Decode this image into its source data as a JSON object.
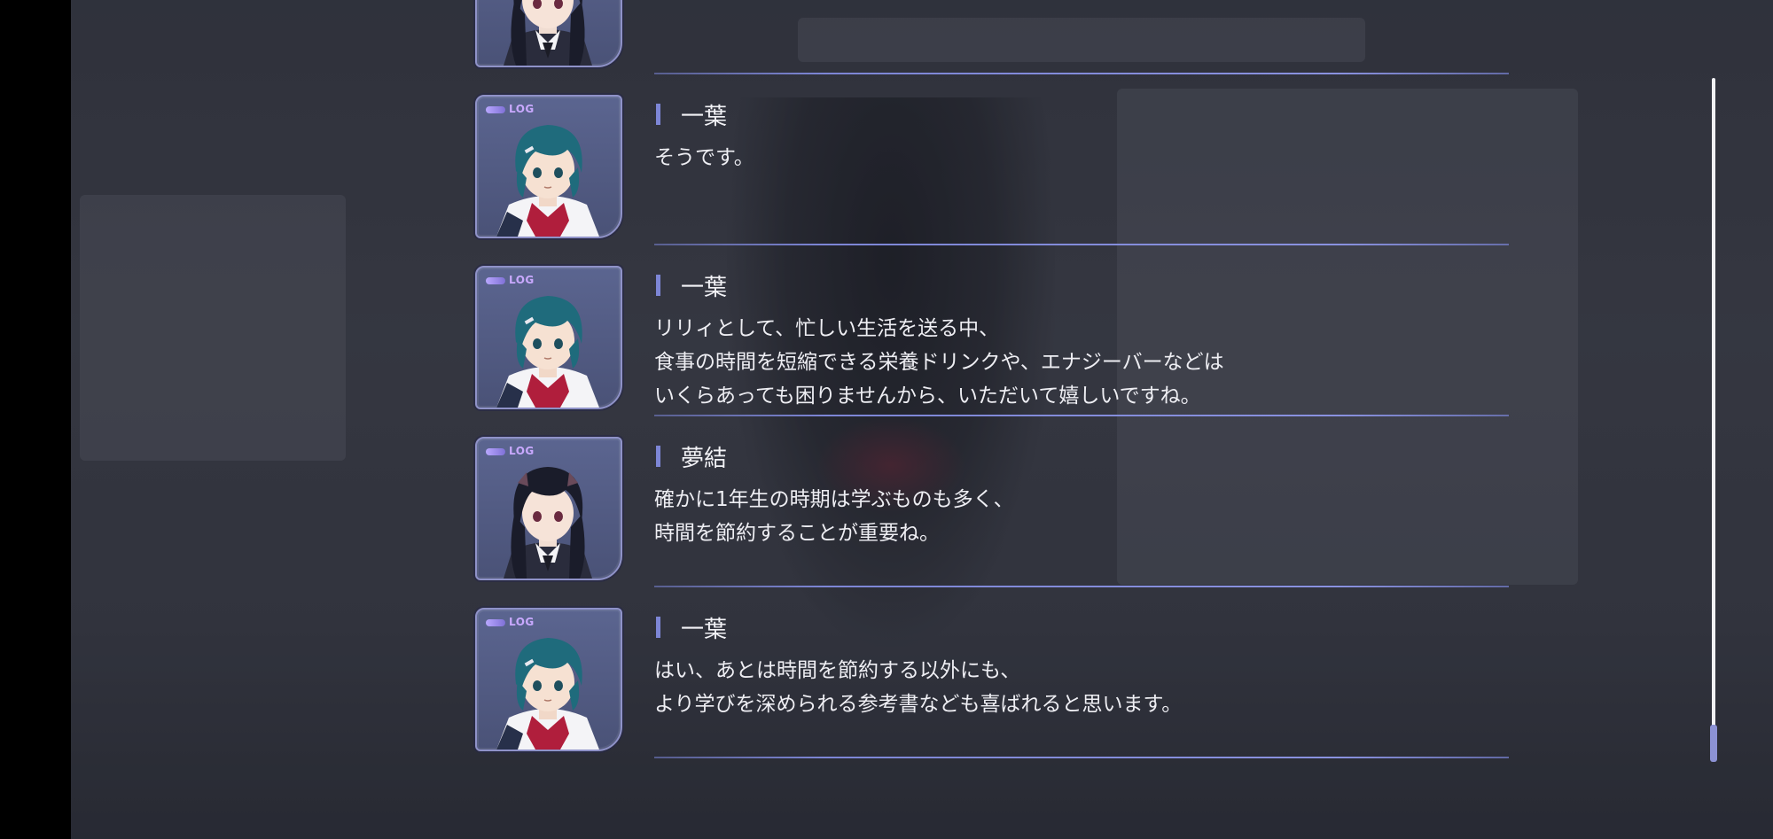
{
  "log_badge": "LOG",
  "entries": [
    {
      "speaker": "",
      "lines": [],
      "character": "yuyu"
    },
    {
      "speaker": "一葉",
      "lines": [
        "そうです。"
      ],
      "character": "kazuha"
    },
    {
      "speaker": "一葉",
      "lines": [
        "リリィとして、忙しい生活を送る中、",
        "食事の時間を短縮できる栄養ドリンクや、エナジーバーなどは",
        "いくらあっても困りませんから、いただいて嬉しいですね。"
      ],
      "character": "kazuha"
    },
    {
      "speaker": "夢結",
      "lines": [
        "確かに1年生の時期は学ぶものも多く、",
        "時間を節約することが重要ね。"
      ],
      "character": "yuyu"
    },
    {
      "speaker": "一葉",
      "lines": [
        "はい、あとは時間を節約する以外にも、",
        "より学びを深められる参考書なども喜ばれると思います。"
      ],
      "character": "kazuha"
    }
  ],
  "scrollbar": {
    "position_fraction": 1.0
  },
  "colors": {
    "accent": "#7d86d6",
    "log_badge": "#c9a9ff",
    "kazuha_hair": "#1f6b7c",
    "yuyu_hair": "#1a1c2a",
    "ribbon": "#b01e3c"
  }
}
